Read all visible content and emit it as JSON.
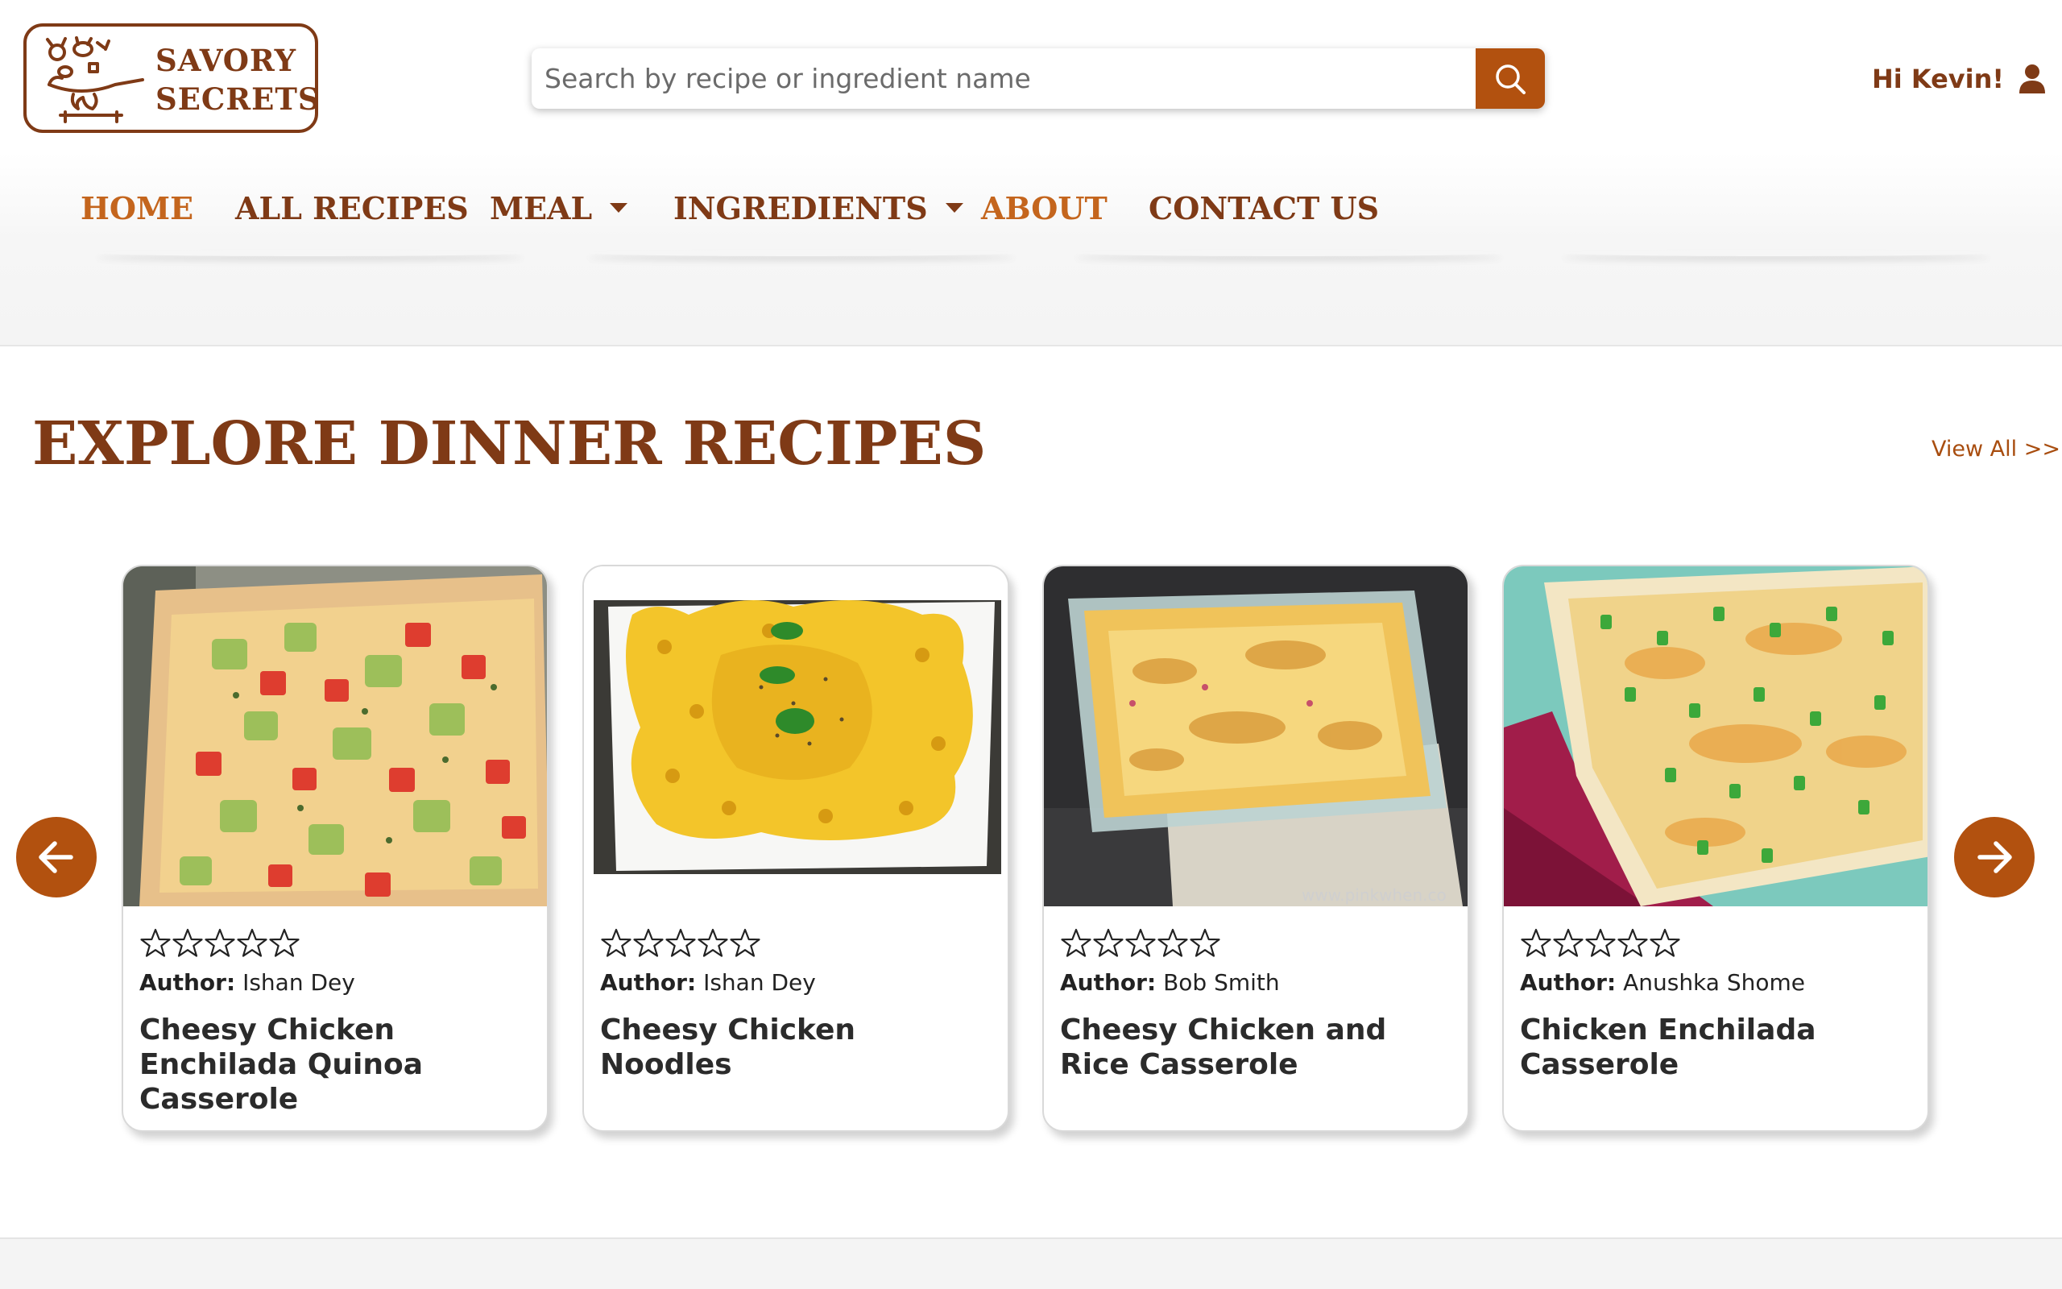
{
  "brand": {
    "line1": "SAVORY",
    "line2": "SECRETS",
    "color": "#7f3a16",
    "icon": "chef-cooking-icon"
  },
  "search": {
    "placeholder": "Search by recipe or ingredient name",
    "value": "",
    "button_icon": "search-icon",
    "button_color": "#b2510f"
  },
  "user": {
    "greeting": "Hi Kevin!",
    "icon": "user-icon"
  },
  "nav": {
    "items": [
      {
        "label": "HOME",
        "active": true
      },
      {
        "label": "ALL RECIPES",
        "active": false
      },
      {
        "label": "MEAL",
        "active": false,
        "dropdown": true
      },
      {
        "label": "INGREDIENTS",
        "active": false,
        "dropdown": true
      },
      {
        "label": "ABOUT",
        "active": true
      },
      {
        "label": "CONTACT US",
        "active": false
      }
    ],
    "active_color": "#c4651d"
  },
  "section": {
    "title": "EXPLORE DINNER RECIPES",
    "view_all": "View All >>"
  },
  "carousel": {
    "prev_icon": "arrow-left-icon",
    "next_icon": "arrow-right-icon"
  },
  "author_label": "Author:",
  "recipes": [
    {
      "author": "Ishan Dey",
      "title": "Cheesy Chicken Enchilada Quinoa Casserole",
      "rating": 0,
      "rating_max": 5
    },
    {
      "author": "Ishan Dey",
      "title": "Cheesy Chicken Noodles",
      "rating": 0,
      "rating_max": 5
    },
    {
      "author": "Bob Smith",
      "title": "Cheesy Chicken and Rice Casserole",
      "rating": 0,
      "rating_max": 5,
      "image_watermark": "www.pinkwhen.co"
    },
    {
      "author": "Anushka Shome",
      "title": "Chicken Enchilada Casserole",
      "rating": 0,
      "rating_max": 5
    }
  ]
}
